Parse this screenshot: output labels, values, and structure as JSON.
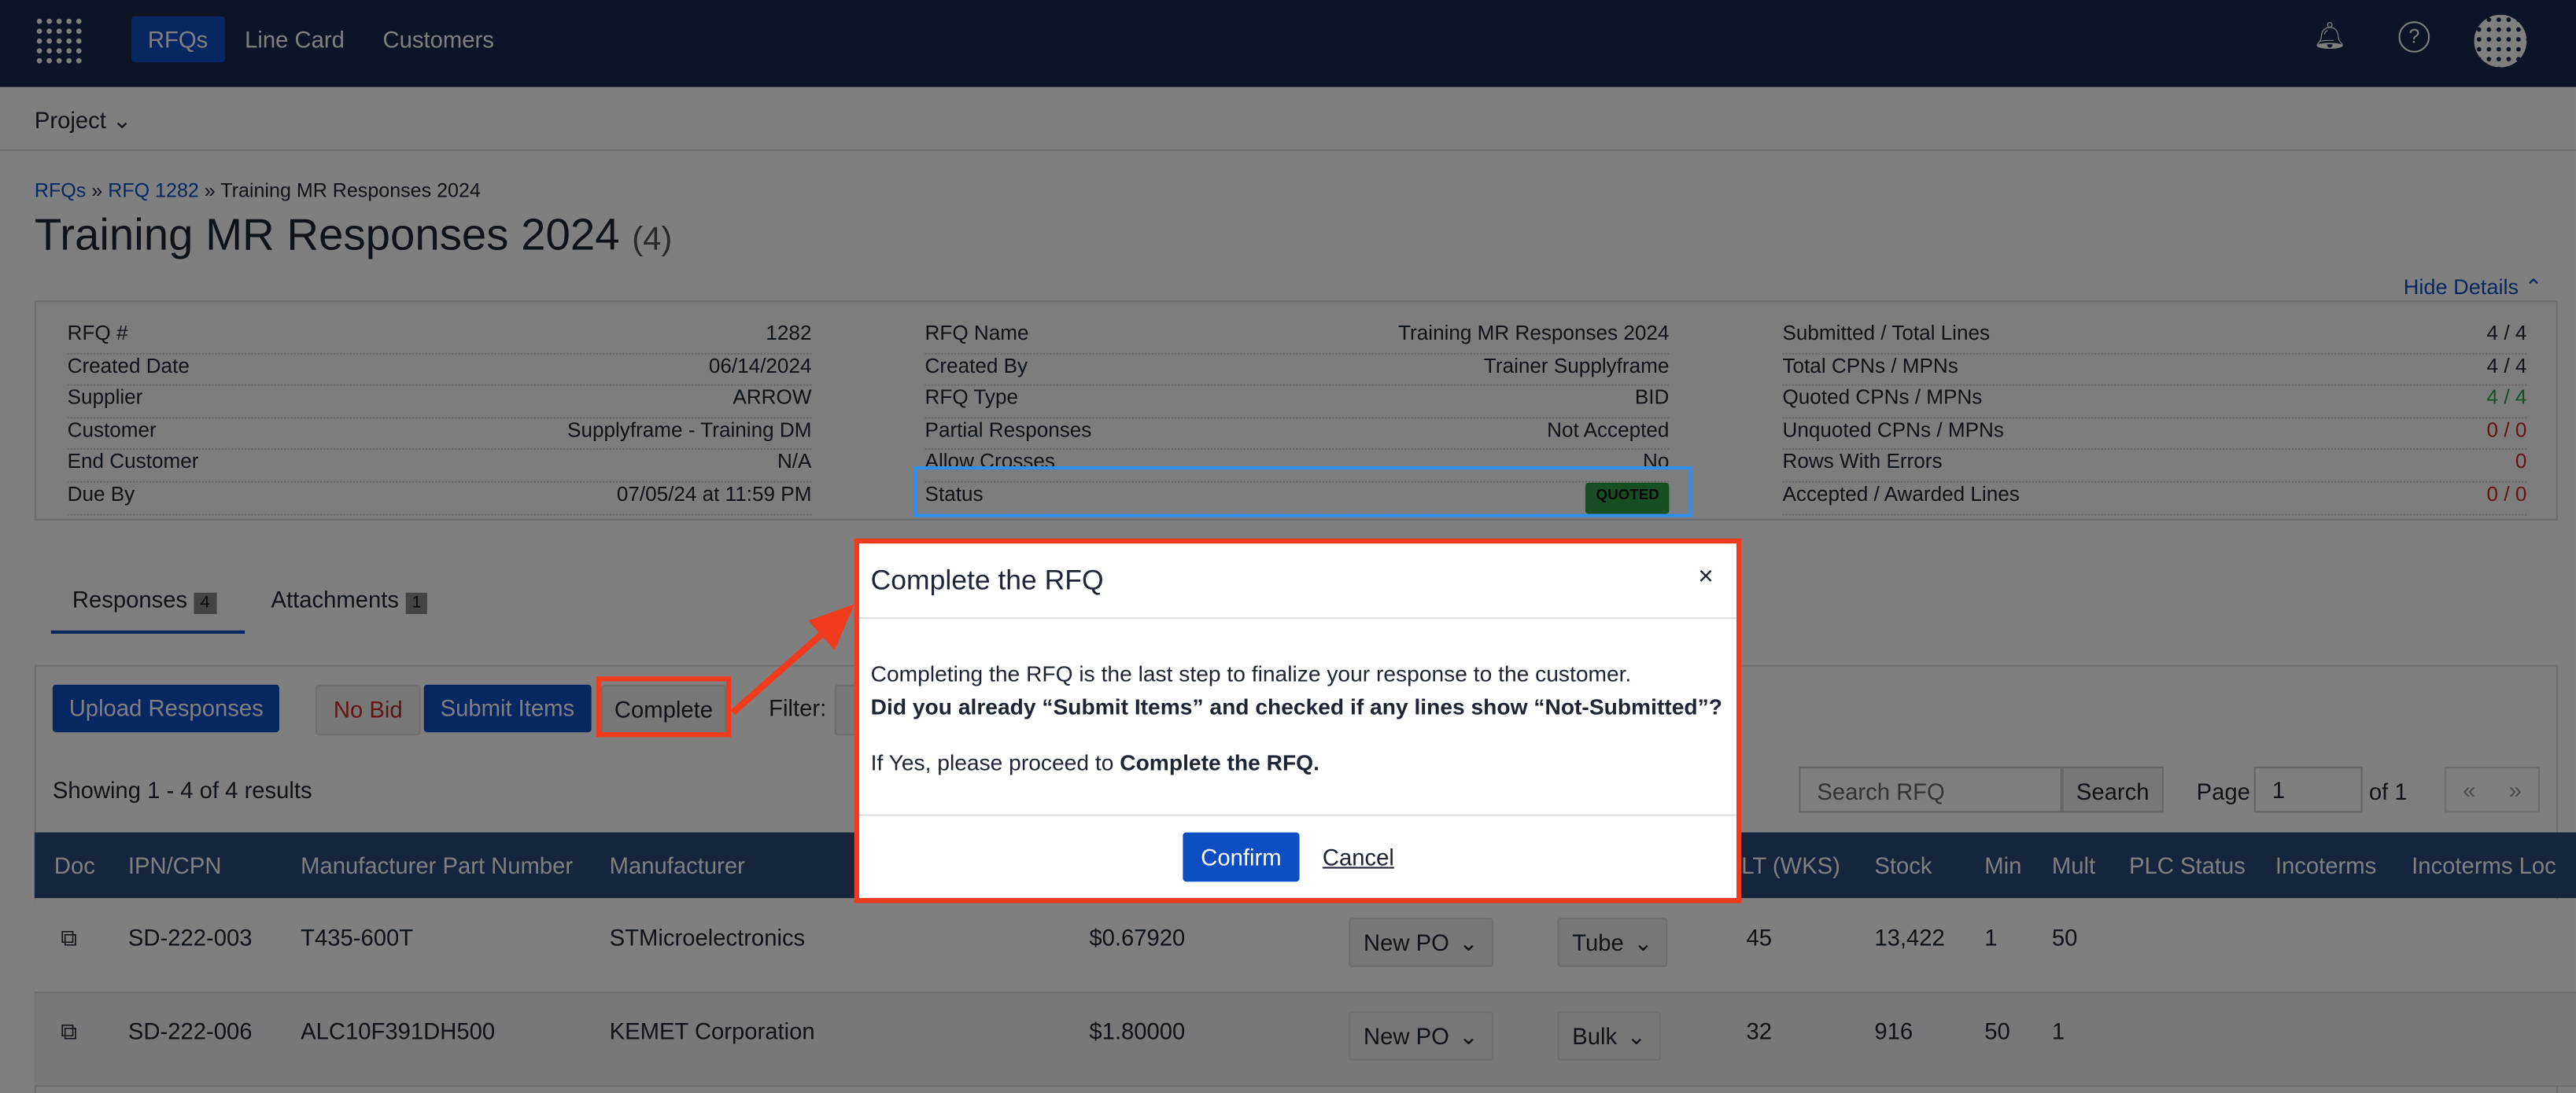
{
  "nav": {
    "items": [
      "RFQs",
      "Line Card",
      "Customers"
    ],
    "active": "RFQs"
  },
  "subnav": {
    "project": "Project"
  },
  "breadcrumb": {
    "rfqs": "RFQs",
    "rfq": "RFQ 1282",
    "current": "Training MR Responses 2024",
    "sep": "»"
  },
  "title": {
    "text": "Training MR Responses 2024",
    "count": "(4)"
  },
  "hide_details": "Hide Details ⌃",
  "details": {
    "col1": [
      [
        "RFQ #",
        "1282"
      ],
      [
        "Created Date",
        "06/14/2024"
      ],
      [
        "Supplier",
        "ARROW"
      ],
      [
        "Customer",
        "Supplyframe - Training DM"
      ],
      [
        "End Customer",
        "N/A"
      ],
      [
        "Due By",
        "07/05/24 at 11:59 PM"
      ]
    ],
    "col2": [
      [
        "RFQ Name",
        "Training MR Responses 2024"
      ],
      [
        "Created By",
        "Trainer Supplyframe"
      ],
      [
        "RFQ Type",
        "BID"
      ],
      [
        "Partial Responses",
        "Not Accepted"
      ],
      [
        "Allow Crosses",
        "No"
      ],
      [
        "Status",
        "QUOTED"
      ]
    ],
    "col3": [
      [
        "Submitted / Total Lines",
        "4 / 4"
      ],
      [
        "Total CPNs / MPNs",
        "4 / 4"
      ],
      [
        "Quoted CPNs / MPNs",
        "4 / 4"
      ],
      [
        "Unquoted CPNs / MPNs",
        "0 / 0"
      ],
      [
        "Rows With Errors",
        "0"
      ],
      [
        "Accepted / Awarded Lines",
        "0 / 0"
      ]
    ]
  },
  "tabs": [
    {
      "label": "Responses",
      "count": "4"
    },
    {
      "label": "Attachments",
      "count": "1"
    }
  ],
  "toolbar": {
    "upload": "Upload Responses",
    "nobid": "No Bid",
    "submit": "Submit Items",
    "complete": "Complete",
    "filter": "Filter:"
  },
  "showing": "Showing 1 - 4 of 4 results",
  "search": {
    "placeholder": "Search RFQ",
    "button": "Search"
  },
  "pager": {
    "label": "Page",
    "value": "1",
    "of": "of 1",
    "prev": "«",
    "next": "»"
  },
  "columns": [
    "Doc",
    "IPN/CPN",
    "Manufacturer Part Number",
    "Manufacturer",
    "LT (WKS)",
    "Stock",
    "Min",
    "Mult",
    "PLC Status",
    "Incoterms",
    "Incoterms Loc"
  ],
  "rows": [
    {
      "ipn": "SD-222-003",
      "mpn": "T435-600T",
      "mfr": "STMicroelectronics",
      "price": "$0.67920",
      "po": "New PO",
      "pkg": "Tube",
      "lt": "45",
      "stock": "13,422",
      "min": "1",
      "mult": "50"
    },
    {
      "ipn": "SD-222-006",
      "mpn": "ALC10F391DH500",
      "mfr": "KEMET Corporation",
      "price": "$1.80000",
      "po": "New PO",
      "pkg": "Bulk",
      "lt": "32",
      "stock": "916",
      "min": "50",
      "mult": "1"
    }
  ],
  "modal": {
    "title": "Complete the RFQ",
    "line1": "Completing the RFQ is the last step to finalize your response to the customer.",
    "line2": "Did you already “Submit Items” and checked if any lines show “Not-Submitted”?",
    "line3a": "If Yes, please proceed to ",
    "line3b": "Complete the RFQ.",
    "confirm": "Confirm",
    "cancel": "Cancel",
    "close": "×"
  },
  "colors": {
    "accent": "#0d4fc2",
    "annotation": "#f23a1c",
    "highlight": "#2e8ff0"
  }
}
